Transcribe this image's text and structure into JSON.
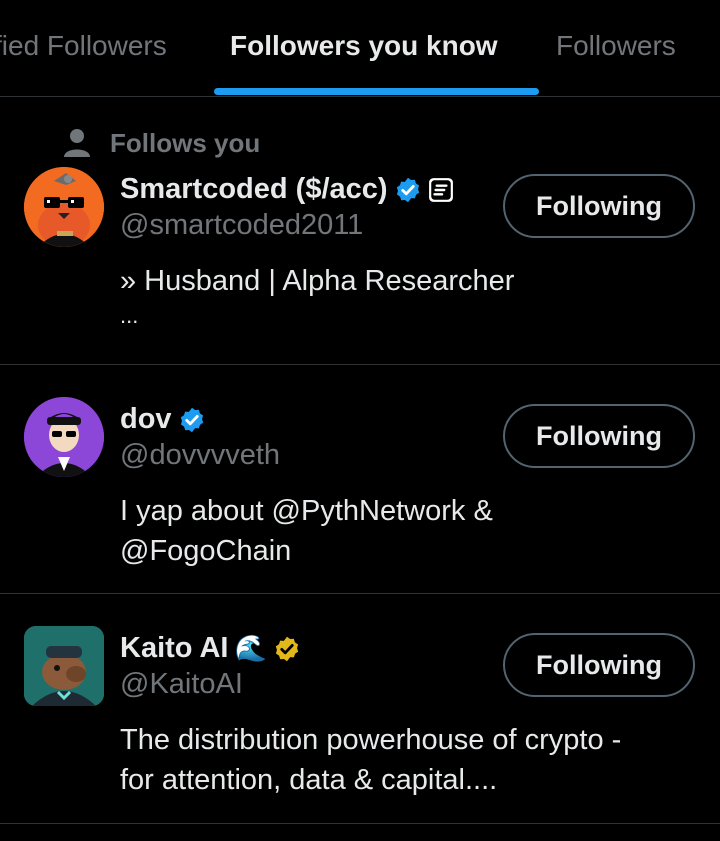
{
  "tabs": [
    {
      "label": "fied Followers",
      "active": false
    },
    {
      "label": "Followers you know",
      "active": true
    },
    {
      "label": "Followers",
      "active": false
    }
  ],
  "colors": {
    "accent": "#1d9bf0",
    "verified_blue": "#1d9bf0",
    "verified_gold": "#e2b719",
    "muted": "#71767b"
  },
  "users": [
    {
      "social_context": "Follows you",
      "name": "Smartcoded ($/acc)",
      "handle": "@smartcoded2011",
      "bio_line1": "» Husband | Alpha Researcher",
      "bio_line2": "...",
      "verified": "blue",
      "affiliate_icon": "affiliate-badge-icon",
      "button": "Following"
    },
    {
      "name": "dov",
      "handle": "@dovvvveth",
      "bio_line1": "I yap about @PythNetwork &",
      "bio_line2": "@FogoChain",
      "verified": "blue",
      "button": "Following"
    },
    {
      "name": "Kaito AI",
      "name_emoji": "🌊",
      "handle": "@KaitoAI",
      "bio_line1": "The distribution powerhouse of crypto -",
      "bio_line2": "for attention, data & capital....",
      "verified": "gold",
      "button": "Following"
    }
  ]
}
